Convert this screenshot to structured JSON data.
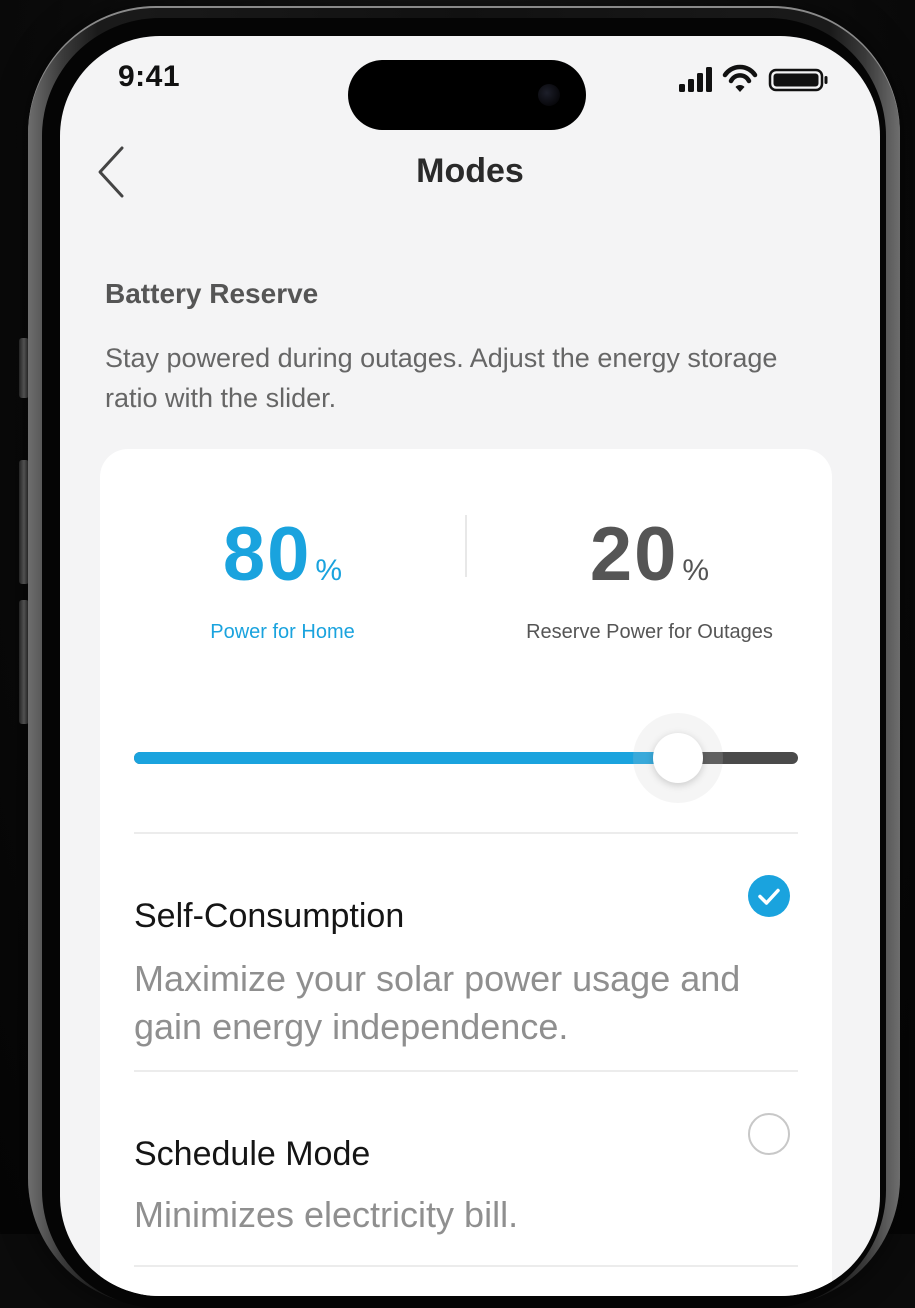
{
  "status_bar": {
    "time": "9:41",
    "icons": [
      "cellular-signal-icon",
      "wifi-icon",
      "battery-icon"
    ]
  },
  "nav": {
    "back_icon": "chevron-left-icon",
    "title": "Modes"
  },
  "battery_reserve": {
    "title": "Battery Reserve",
    "description": "Stay powered during outages. Adjust the energy storage ratio with the slider.",
    "home": {
      "value": "80",
      "unit": "%",
      "label": "Power for Home"
    },
    "reserve": {
      "value": "20",
      "unit": "%",
      "label": "Reserve Power for Outages"
    },
    "slider_level_percent": 82
  },
  "modes": [
    {
      "title": "Self-Consumption",
      "description": "Maximize your solar power usage and gain energy independence.",
      "selected": true
    },
    {
      "title": "Schedule Mode",
      "description": "Minimizes electricity bill.",
      "selected": false
    }
  ],
  "colors": {
    "accent": "#1aa3de",
    "reserve": "#4a4a4a",
    "background": "#f4f4f5",
    "card": "#ffffff"
  }
}
